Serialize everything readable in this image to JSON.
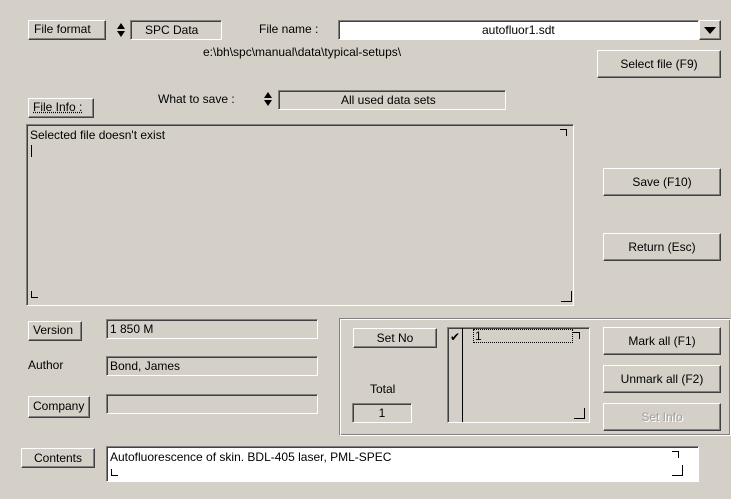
{
  "file_format": {
    "label": "File format",
    "value": "SPC Data"
  },
  "file_name": {
    "label": "File name :",
    "value": "autofluor1.sdt"
  },
  "path": "e:\\bh\\spc\\manual\\data\\typical-setups\\",
  "select_file_button": "Select file (F9)",
  "file_info": {
    "label": "File Info :",
    "text": "Selected file doesn't exist"
  },
  "what_to_save": {
    "label": "What to save :",
    "value": "All used data sets"
  },
  "buttons": {
    "save": "Save (F10)",
    "return": "Return (Esc)",
    "mark_all": "Mark all (F1)",
    "unmark_all": "Unmark all (F2)",
    "set_info": "Set Info"
  },
  "version": {
    "label": "Version",
    "value": "1  850 M"
  },
  "author": {
    "label": "Author",
    "value": "Bond, James"
  },
  "company": {
    "label": "Company",
    "value": ""
  },
  "sets": {
    "set_no_label": "Set No",
    "total_label": "Total",
    "total_value": "1",
    "items": [
      {
        "checked": true,
        "check_mark": "✔",
        "label": "1"
      }
    ]
  },
  "contents": {
    "label": "Contents",
    "value": "Autofluorescence of skin. BDL-405 laser, PML-SPEC"
  }
}
